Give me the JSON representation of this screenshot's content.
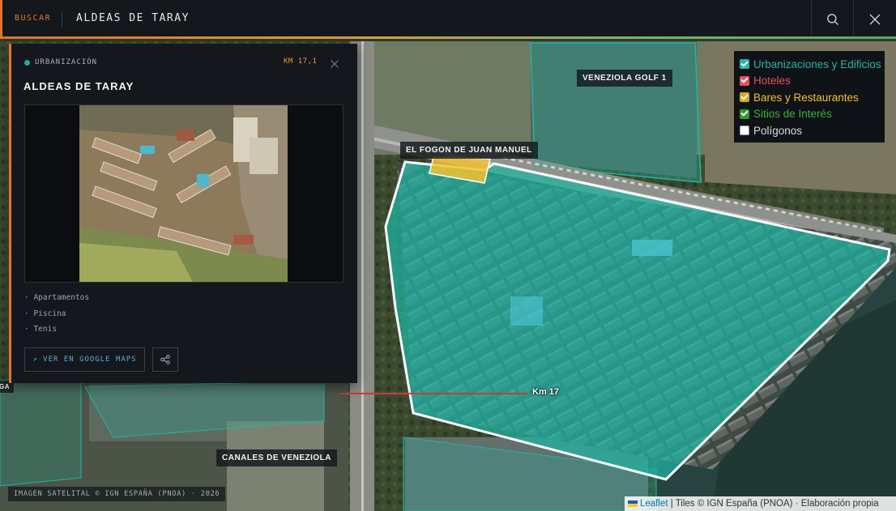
{
  "search": {
    "label": "BUSCAR",
    "query": "ALDEAS DE TARAY",
    "search_icon": "search-icon",
    "close_icon": "close-icon"
  },
  "panel": {
    "category": "URBANIZACIÓN",
    "km": "KM 17,1",
    "title": "ALDEAS DE TARAY",
    "features": [
      "· Apartamentos",
      "· Piscina",
      "· Tenis"
    ],
    "google_maps_button": "↗ VER EN GOOGLE MAPS",
    "share_icon": "share-icon",
    "close_icon": "close-icon",
    "accent_color": "#e8732c",
    "category_dot_color": "#2ba79a"
  },
  "layers": [
    {
      "label": "Urbanizaciones y Edificios",
      "checked": true,
      "color": "#2bb3a8"
    },
    {
      "label": "Hoteles",
      "checked": true,
      "color": "#e05260"
    },
    {
      "label": "Bares y Restaurantes",
      "checked": true,
      "color": "#f2c230"
    },
    {
      "label": "Sitios de Interés",
      "checked": true,
      "color": "#3fae3f"
    },
    {
      "label": "Polígonos",
      "checked": false,
      "color": "#d9dde1"
    }
  ],
  "map": {
    "labels": {
      "veneziola_golf": "VENEZIOLA GOLF 1",
      "fogon": "EL FOGON DE JUAN MANUEL",
      "canales": "CANALES DE VENEZIOLA",
      "km_marker": "Km 17",
      "left_edge": "GA"
    },
    "polygon_color": "#1fb5a3",
    "restaurant_color": "#f2c230"
  },
  "footer": {
    "imagery_credit": "IMAGEN SATELITAL © IGN ESPAÑA (PNOA) · 2026",
    "leaflet_link": "Leaflet",
    "attribution_rest": " | Tiles © IGN España (PNOA) · Elaboración propia"
  }
}
